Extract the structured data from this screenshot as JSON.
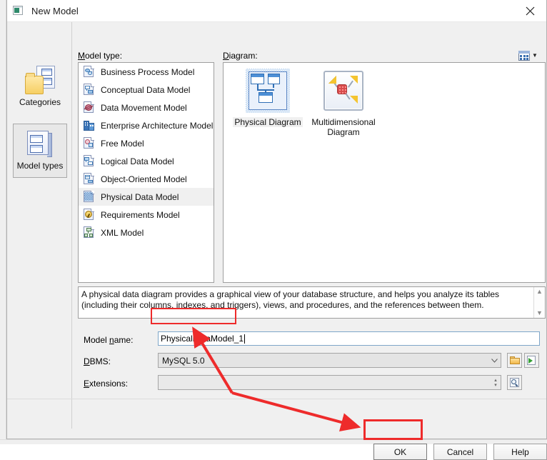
{
  "window": {
    "title": "New Model",
    "icon": "new-model-icon",
    "close_label": "✕"
  },
  "toolbar": {
    "view_mode_icon": "grid-view-icon",
    "view_mode_chevron": "▼"
  },
  "sidebar": {
    "items": [
      {
        "label": "Categories",
        "icon": "categories-icon",
        "selected": false
      },
      {
        "label": "Model types",
        "icon": "model-types-icon",
        "selected": true
      }
    ]
  },
  "model_type": {
    "label": "Model type:",
    "label_accel": "M",
    "items": [
      {
        "label": "Business Process Model",
        "icon": "business-process-model-icon",
        "selected": false
      },
      {
        "label": "Conceptual Data Model",
        "icon": "conceptual-data-model-icon",
        "selected": false
      },
      {
        "label": "Data Movement Model",
        "icon": "data-movement-model-icon",
        "selected": false
      },
      {
        "label": "Enterprise Architecture Model",
        "icon": "enterprise-architecture-model-icon",
        "selected": false
      },
      {
        "label": "Free Model",
        "icon": "free-model-icon",
        "selected": false
      },
      {
        "label": "Logical Data Model",
        "icon": "logical-data-model-icon",
        "selected": false
      },
      {
        "label": "Object-Oriented Model",
        "icon": "object-oriented-model-icon",
        "selected": false
      },
      {
        "label": "Physical Data Model",
        "icon": "physical-data-model-icon",
        "selected": true
      },
      {
        "label": "Requirements Model",
        "icon": "requirements-model-icon",
        "selected": false
      },
      {
        "label": "XML Model",
        "icon": "xml-model-icon",
        "selected": false
      }
    ]
  },
  "diagram": {
    "label": "Diagram:",
    "label_accel": "D",
    "items": [
      {
        "label": "Physical Diagram",
        "icon": "physical-diagram-icon",
        "selected": true
      },
      {
        "label": "Multidimensional Diagram",
        "icon": "multidimensional-diagram-icon",
        "selected": false
      }
    ]
  },
  "description": {
    "text": "A physical data diagram provides a graphical view of your database structure, and helps you analyze its tables (including their columns, indexes, and triggers), views, and procedures, and the references between them.",
    "scroll_up": "▲",
    "scroll_down": "▼"
  },
  "form": {
    "model_name": {
      "label": "Model name:",
      "label_accel": "n",
      "value": "PhysicalDataModel_1"
    },
    "dbms": {
      "label": "DBMS:",
      "label_accel": "D",
      "value": "MySQL 5.0",
      "chevron": "⌵",
      "buttons": [
        {
          "name": "dbms-folder-button",
          "icon": "folder-icon"
        },
        {
          "name": "dbms-new-button",
          "icon": "green-arrow-icon"
        }
      ]
    },
    "extensions": {
      "label": "Extensions:",
      "label_accel": "E",
      "value": "",
      "spinner_up": "▴",
      "spinner_down": "▾",
      "browse_icon": "magnifier-icon"
    }
  },
  "footer": {
    "ok": "OK",
    "cancel": "Cancel",
    "help": "Help"
  },
  "annotations": {
    "highlight_color": "#ee2b2b",
    "targets": [
      "model-name-input",
      "ok-button"
    ]
  }
}
